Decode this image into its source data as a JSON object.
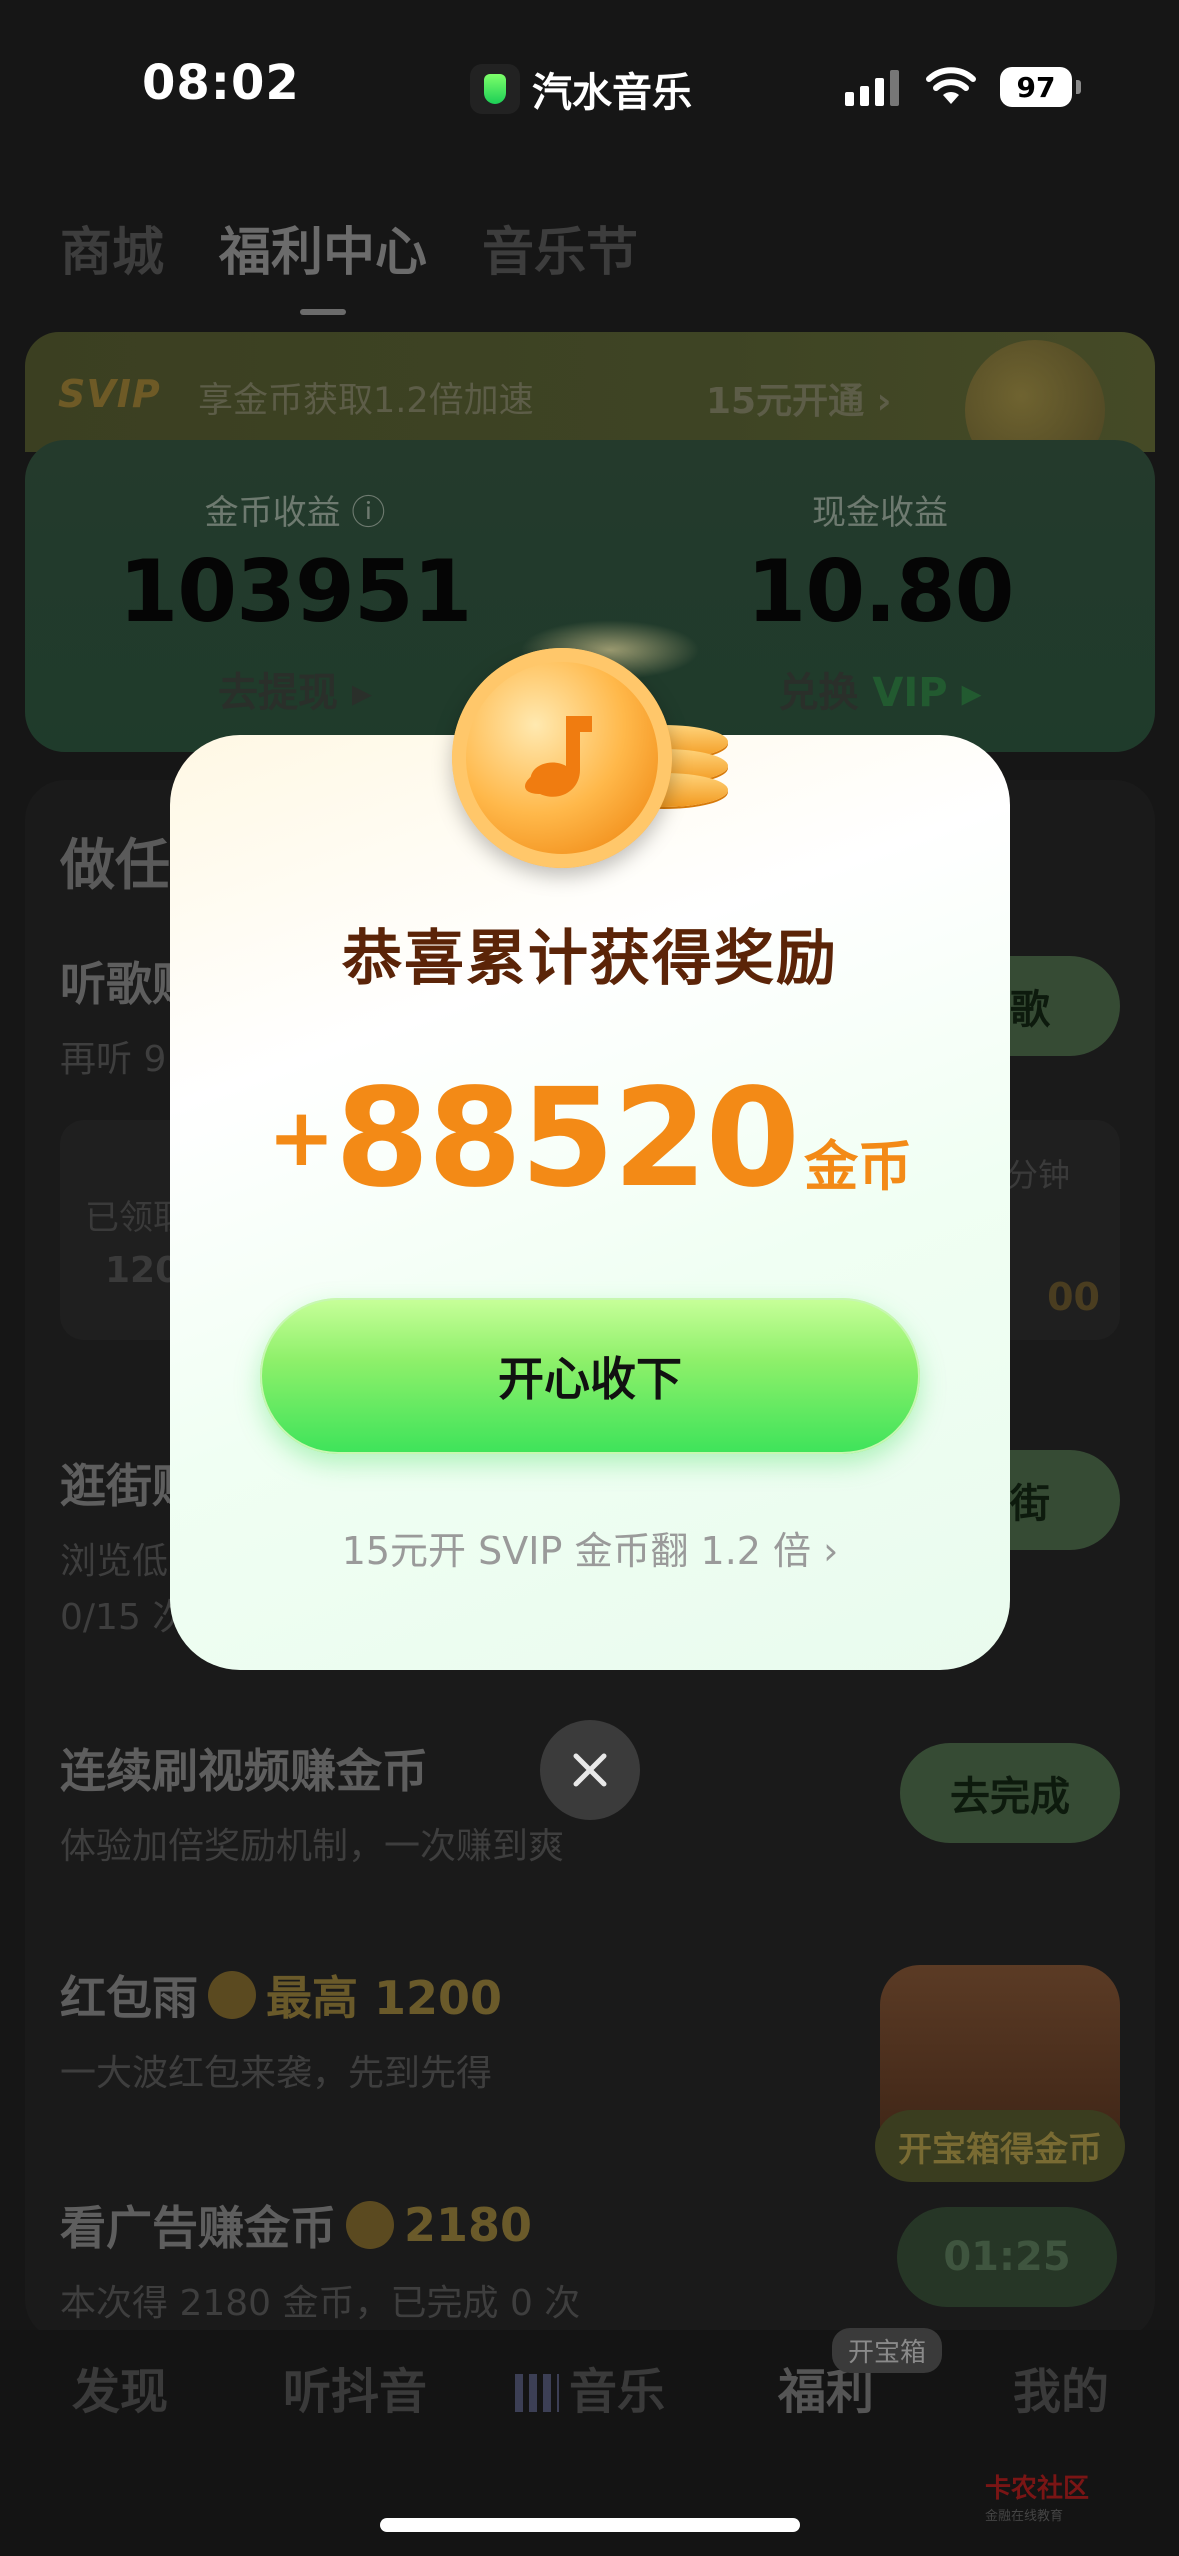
{
  "status_bar": {
    "time": "08:02",
    "app_name": "汽水音乐",
    "battery": "97"
  },
  "top_tabs": [
    "商城",
    "福利中心",
    "音乐节"
  ],
  "active_top_tab": "福利中心",
  "svip_banner": {
    "logo": "SVIP",
    "text": "享金币获取1.2倍加速",
    "price": "15元开通 ›"
  },
  "earnings": {
    "coin_label": "金币收益 ⓘ",
    "coin_value": "103951",
    "coin_action": "去提现 ▸",
    "cash_label": "现金收益",
    "cash_value": "10.80",
    "cash_action": "兑换",
    "cash_action_vip": "VIP ▸"
  },
  "tasks": {
    "section_title": "做任",
    "listen": {
      "title": "听歌赚",
      "sub": "再听 9",
      "button": "听歌"
    },
    "listen_box": {
      "claimed": "已领取",
      "claimed_value": "120",
      "minutes": "分钟",
      "reward": "00"
    },
    "shop": {
      "title": "逛街赚",
      "sub1": "浏览低",
      "sub2": "0/15 次",
      "button": "逛街"
    },
    "video": {
      "title": "连续刷视频赚金币",
      "sub": "体验加倍奖励机制，一次赚到爽",
      "button": "去完成"
    },
    "red_packet": {
      "title": "红包雨",
      "amount": "最高 1200",
      "sub": "一大波红包来袭，先到先得"
    },
    "ads": {
      "title": "看广告赚金币",
      "amount": "2180",
      "sub": "本次得 2180 金币，已完成 0 次",
      "button": "01:25"
    },
    "treasure_label": "开宝箱得金币"
  },
  "bottom_nav": {
    "items": [
      "发现",
      "听抖音",
      "音乐",
      "福利",
      "我的"
    ],
    "active": "福利",
    "badge": "开宝箱"
  },
  "modal": {
    "title": "恭喜累计获得奖励",
    "plus": "+",
    "amount": "88520",
    "unit": "金币",
    "confirm": "开心收下",
    "svip_tip": "15元开 SVIP 金币翻 1.2 倍 ›"
  },
  "watermark": {
    "main": "卡农社区",
    "sub": "金融在线教育"
  },
  "colors": {
    "accent_orange": "#f38a16",
    "title_brown": "#5b2408",
    "button_green": "#3de35a"
  }
}
